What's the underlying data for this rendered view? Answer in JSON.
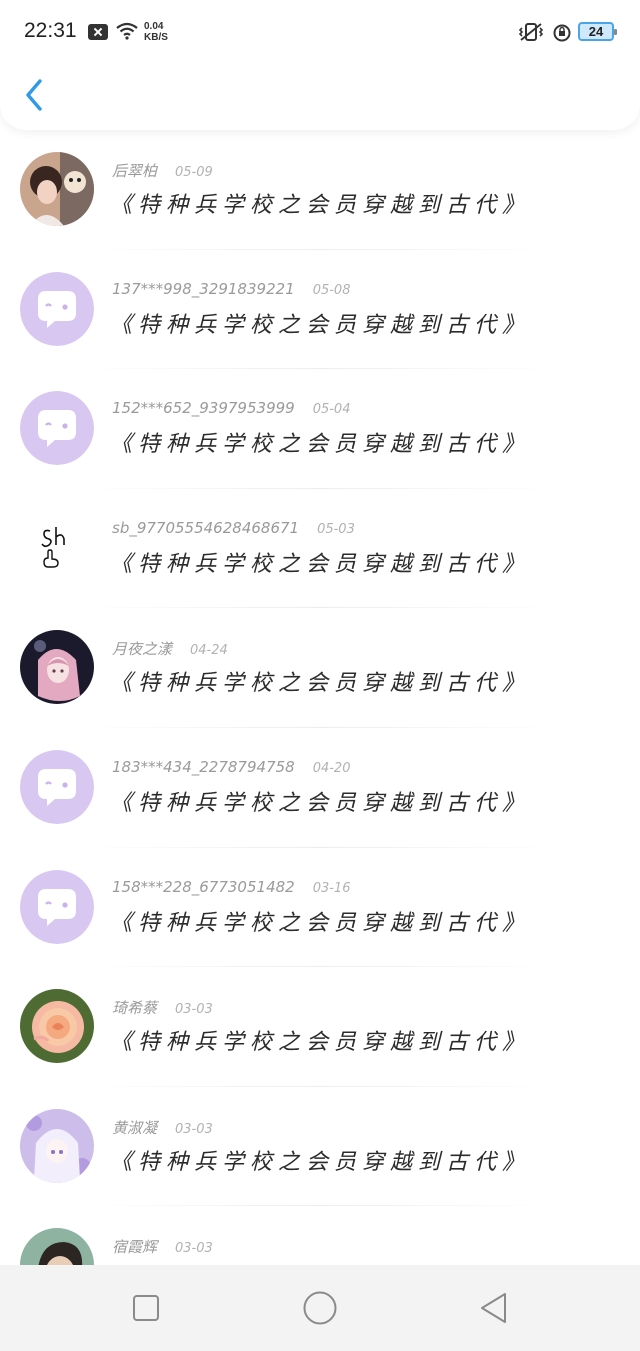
{
  "status_bar": {
    "time": "22:31",
    "net_speed_value": "0.04",
    "net_speed_unit": "KB/S",
    "battery": "24",
    "icons": [
      "notification-x-icon",
      "wifi-icon",
      "vibrate-icon",
      "alarm-icon",
      "battery-icon"
    ]
  },
  "header": {
    "back_icon": "chevron-left-icon"
  },
  "colors": {
    "accent": "#2f9ae8",
    "placeholder_avatar": "#d8c7f0",
    "placeholder_bubble": "#ffffff"
  },
  "comments": [
    {
      "user": "后翠柏",
      "date": "05-09",
      "text": "《特种兵学校之会员穿越到古代》",
      "avatar": "photo-girl"
    },
    {
      "user": "137***998_3291839221",
      "date": "05-08",
      "text": "《特种兵学校之会员穿越到古代》",
      "avatar": "default-chat"
    },
    {
      "user": "152***652_9397953999",
      "date": "05-04",
      "text": "《特种兵学校之会员穿越到古代》",
      "avatar": "default-chat"
    },
    {
      "user": "sb_97705554628468671",
      "date": "05-03",
      "text": "《特种兵学校之会员穿越到古代》",
      "avatar": "doodle-sb"
    },
    {
      "user": "月夜之漾",
      "date": "04-24",
      "text": "《特种兵学校之会员穿越到古代》",
      "avatar": "anime-pink-hair"
    },
    {
      "user": "183***434_2278794758",
      "date": "04-20",
      "text": "《特种兵学校之会员穿越到古代》",
      "avatar": "default-chat"
    },
    {
      "user": "158***228_6773051482",
      "date": "03-16",
      "text": "《特种兵学校之会员穿越到古代》",
      "avatar": "default-chat"
    },
    {
      "user": "琦希蔡",
      "date": "03-03",
      "text": "《特种兵学校之会员穿越到古代》",
      "avatar": "rose-flower"
    },
    {
      "user": "黄淑凝",
      "date": "03-03",
      "text": "《特种兵学校之会员穿越到古代》",
      "avatar": "anime-lilac"
    },
    {
      "user": "宿霞辉",
      "date": "03-03",
      "text": "",
      "avatar": "photo-man"
    }
  ],
  "nav_bar": {
    "icons": [
      "recent-apps-square-icon",
      "home-circle-icon",
      "back-triangle-icon"
    ]
  }
}
